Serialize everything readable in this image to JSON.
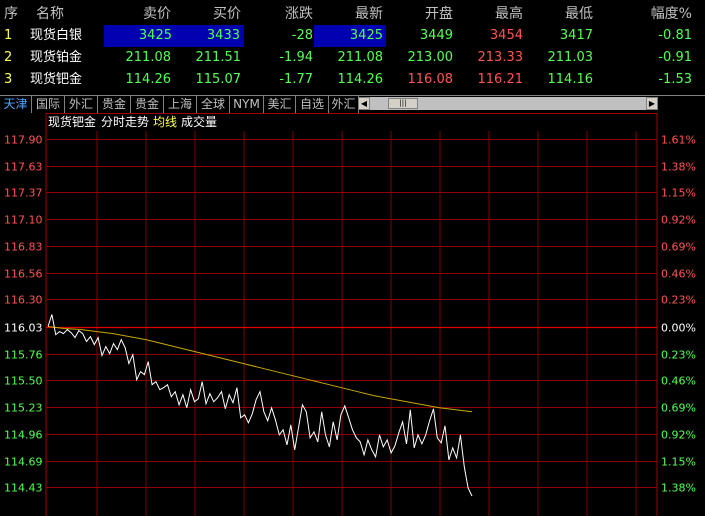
{
  "quote_table": {
    "headers": [
      "序",
      "名称",
      "卖价",
      "买价",
      "涨跌",
      "最新",
      "开盘",
      "最高",
      "最低",
      "幅度%"
    ],
    "rows": [
      {
        "no": "1",
        "name": "现货白银",
        "sell": "3425",
        "buy": "3433",
        "change": "-28",
        "last": "3425",
        "open": "3449",
        "high": "3454",
        "low": "3417",
        "pct": "-0.81"
      },
      {
        "no": "2",
        "name": "现货铂金",
        "sell": "211.08",
        "buy": "211.51",
        "change": "-1.94",
        "last": "211.08",
        "open": "213.00",
        "high": "213.33",
        "low": "211.03",
        "pct": "-0.91"
      },
      {
        "no": "3",
        "name": "现货钯金",
        "sell": "114.26",
        "buy": "115.07",
        "change": "-1.77",
        "last": "114.26",
        "open": "116.08",
        "high": "116.21",
        "low": "114.16",
        "pct": "-1.53"
      }
    ]
  },
  "tabs": [
    "天津",
    "国际",
    "外汇",
    "贵金",
    "贵金",
    "上海",
    "全球",
    "NYM",
    "美汇",
    "自选",
    "外汇"
  ],
  "active_tab": 0,
  "chart_header": {
    "instrument": "现货钯金",
    "mode": "分时走势",
    "avg_label": "均线",
    "vol_label": "成交量"
  },
  "chart_data": {
    "type": "line",
    "y_left_ticks": [
      "117.90",
      "117.63",
      "117.37",
      "117.10",
      "116.83",
      "116.56",
      "116.30",
      "116.03",
      "115.76",
      "115.50",
      "115.23",
      "114.96",
      "114.69",
      "114.43"
    ],
    "y_right_ticks": [
      "1.61%",
      "1.38%",
      "1.15%",
      "0.92%",
      "0.69%",
      "0.46%",
      "0.23%",
      "0.00%",
      "0.23%",
      "0.46%",
      "0.69%",
      "0.92%",
      "1.15%",
      "1.38%"
    ],
    "ylim": [
      114.3,
      118.0
    ],
    "base_price": 116.03,
    "grid": true,
    "series": [
      {
        "values": [
          116.03,
          116.15,
          115.95,
          115.98,
          115.96,
          116.0,
          115.97,
          115.92,
          115.99,
          115.96,
          115.88,
          115.93,
          115.85,
          115.92,
          115.74,
          115.83,
          115.76,
          115.86,
          115.8,
          115.9,
          115.82,
          115.66,
          115.75,
          115.5,
          115.58,
          115.55,
          115.68,
          115.45,
          115.48,
          115.4,
          115.42,
          115.45,
          115.33,
          115.38,
          115.25,
          115.35,
          115.22,
          115.4,
          115.28,
          115.31,
          115.48,
          115.26,
          115.36,
          115.28,
          115.32,
          115.38,
          115.21,
          115.35,
          115.27,
          115.42,
          115.12,
          115.15,
          115.07,
          115.16,
          115.3,
          115.38,
          115.18,
          115.09,
          115.22,
          115.1,
          114.95,
          115.0,
          114.85,
          115.05,
          114.8,
          115.02,
          115.25,
          115.18,
          114.92,
          114.98,
          114.88,
          115.18,
          114.95,
          114.83,
          115.08,
          114.9,
          115.15,
          115.24,
          115.12,
          115.0,
          114.92,
          114.88,
          114.75,
          114.9,
          114.8,
          114.73,
          114.95,
          114.83,
          114.9,
          114.77,
          114.84,
          114.97,
          115.08,
          114.86,
          115.2,
          114.82,
          114.95,
          114.86,
          114.95,
          115.09,
          115.21,
          114.92,
          114.87,
          115.04,
          114.7,
          114.82,
          114.72,
          114.95,
          114.63,
          114.42,
          114.34
        ]
      },
      {
        "values": [
          116.03,
          116.01,
          116.0,
          115.98,
          115.96,
          115.93,
          115.9,
          115.86,
          115.82,
          115.78,
          115.74,
          115.7,
          115.66,
          115.62,
          115.58,
          115.54,
          115.5,
          115.46,
          115.42,
          115.38,
          115.34,
          115.31,
          115.28,
          115.25,
          115.22,
          115.2,
          115.18
        ]
      }
    ]
  }
}
